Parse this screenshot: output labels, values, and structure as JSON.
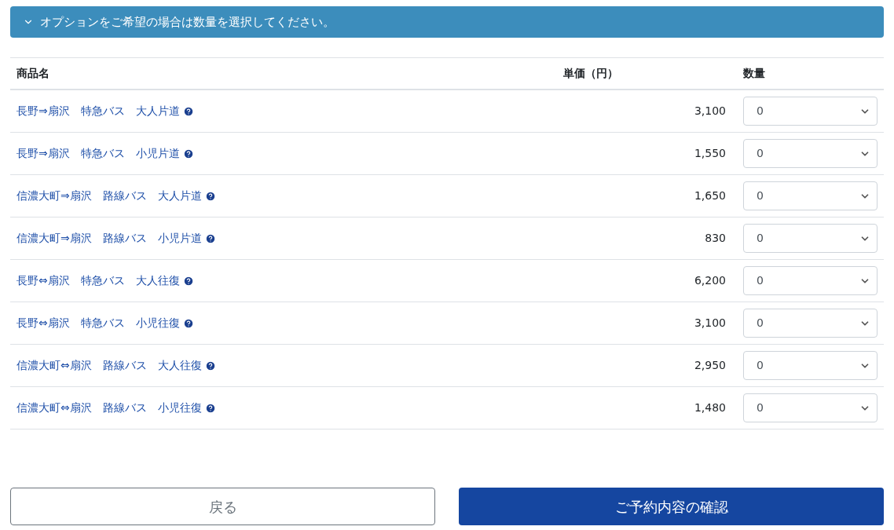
{
  "banner": {
    "text": "オプションをご希望の場合は数量を選択してください。",
    "expanded": true
  },
  "table": {
    "columns": [
      "商品名",
      "単価（円）",
      "数量"
    ],
    "rows": [
      {
        "name": "長野⇒扇沢　特急バス　大人片道",
        "price": "3,100",
        "quantity": "0"
      },
      {
        "name": "長野⇒扇沢　特急バス　小児片道",
        "price": "1,550",
        "quantity": "0"
      },
      {
        "name": "信濃大町⇒扇沢　路線バス　大人片道",
        "price": "1,650",
        "quantity": "0"
      },
      {
        "name": "信濃大町⇒扇沢　路線バス　小児片道",
        "price": "830",
        "quantity": "0"
      },
      {
        "name": "長野⇔扇沢　特急バス　大人往復",
        "price": "6,200",
        "quantity": "0"
      },
      {
        "name": "長野⇔扇沢　特急バス　小児往復",
        "price": "3,100",
        "quantity": "0"
      },
      {
        "name": "信濃大町⇔扇沢　路線バス　大人往復",
        "price": "2,950",
        "quantity": "0"
      },
      {
        "name": "信濃大町⇔扇沢　路線バス　小児往復",
        "price": "1,480",
        "quantity": "0"
      }
    ]
  },
  "buttons": {
    "back": "戻る",
    "confirm": "ご予約内容の確認"
  }
}
